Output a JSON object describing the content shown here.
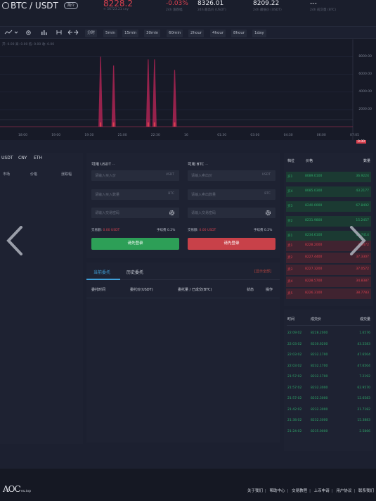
{
  "header": {
    "pair": "BTC / USDT",
    "intro_badge": "简介",
    "price": "8228.2",
    "price_sub": "≈ 56723.21 cny",
    "change": "-0.03%",
    "change_label": "24h 涨跌幅",
    "high": "8326.01",
    "high_label": "24h 最高价 (USDT)",
    "low": "8209.22",
    "low_label": "24h 最低价 (USDT)",
    "volume": "---",
    "volume_label": "24h 成交量 (BTC)"
  },
  "chart": {
    "toolbar": [
      "分时",
      "5min",
      "15min",
      "30min",
      "60min",
      "2hour",
      "4hour",
      "8hour",
      "1day"
    ],
    "legend": "开: 0.00  高: 0.00  低: 0.00  收: 0.00",
    "current_price_tag": "0.00",
    "colors": {
      "spike": "#c2265a",
      "accent": "#d9414f"
    }
  },
  "chart_data": {
    "type": "line",
    "x_ticks": [
      "18:00",
      "19:00",
      "19:30",
      "21:00",
      "22:30",
      "16",
      "01:30",
      "03:00",
      "04:30",
      "06:00",
      "07:05"
    ],
    "y_ticks": [
      "8000.00",
      "6000.00",
      "4000.00",
      "2000.00"
    ],
    "ylim": [
      0,
      9000
    ],
    "spikes": [
      {
        "x": 0.285,
        "value": 8000
      },
      {
        "x": 0.322,
        "value": 7000
      },
      {
        "x": 0.42,
        "value": 7700
      },
      {
        "x": 0.438,
        "value": 7700
      },
      {
        "x": 0.495,
        "value": 6500
      }
    ]
  },
  "market": {
    "tabs": [
      "USDT",
      "CNY",
      "ETH"
    ],
    "columns": [
      "市场",
      "价格",
      "涨跌幅"
    ]
  },
  "trade": {
    "buy_title": "可用 USDT",
    "buy_title_suffix": "--",
    "sell_title": "可用 BTC",
    "sell_title_suffix": "--",
    "buy_price_ph": "请输入买入价",
    "buy_amount_ph": "请输入买入数量",
    "buy_pwd_ph": "请输入交易密码",
    "sell_price_ph": "请输入卖出价",
    "sell_amount_ph": "请输入卖出数量",
    "sell_pwd_ph": "请输入交易密码",
    "unit_usdt": "USDT",
    "unit_btc": "BTC",
    "buy_total_label": "交易额:",
    "buy_total_value": "0.00 USDT",
    "buy_fee": "手续费 0.2%",
    "sell_total_label": "交易额:",
    "sell_total_value": "0.00 USDT",
    "sell_fee": "手续费 0.2%",
    "buy_button": "请先登录",
    "sell_button": "请先登录"
  },
  "orders": {
    "tab_current": "当前委托",
    "tab_history": "历史委托",
    "show_all": "[显示全部]",
    "columns": [
      "委托时间",
      "委托价(USDT)",
      "委托量 / 已成交(BTC)",
      "状态",
      "操作"
    ]
  },
  "book": {
    "columns": [
      "档位",
      "价格",
      "数量"
    ],
    "bids": [
      {
        "level": "买1",
        "price": "8089.0100",
        "amount": "36.9224"
      },
      {
        "level": "买4",
        "price": "8085.0300",
        "amount": "43.2177"
      },
      {
        "level": "买3",
        "price": "8240.0000",
        "amount": "67.8492"
      },
      {
        "level": "买2",
        "price": "8231.9800",
        "amount": "15.2457"
      },
      {
        "level": "买1",
        "price": "8234.6100",
        "amount": "15.7414"
      }
    ],
    "asks": [
      {
        "level": "卖1",
        "price": "8228.2000",
        "amount": "2.0472"
      },
      {
        "level": "卖2",
        "price": "8227.4400",
        "amount": "37.3307"
      },
      {
        "level": "卖3",
        "price": "8227.3200",
        "amount": "37.0572"
      },
      {
        "level": "卖4",
        "price": "8228.5700",
        "amount": "34.8387"
      },
      {
        "level": "卖5",
        "price": "8226.3100",
        "amount": "38.7783"
      }
    ]
  },
  "trades": {
    "columns": [
      "时间",
      "成交价",
      "成交量"
    ],
    "rows": [
      {
        "time": "22:09:02",
        "price": "8228.2000",
        "amount": "1.6576"
      },
      {
        "time": "22:03:02",
        "price": "8230.6200",
        "amount": "43.5583"
      },
      {
        "time": "22:03:02",
        "price": "8232.1700",
        "amount": "47.6504"
      },
      {
        "time": "22:03:02",
        "price": "8232.1700",
        "amount": "47.6504"
      },
      {
        "time": "21:57:02",
        "price": "8232.1700",
        "amount": "7.2192"
      },
      {
        "time": "21:57:02",
        "price": "8232.3000",
        "amount": "62.9570"
      },
      {
        "time": "21:57:02",
        "price": "8232.3000",
        "amount": "12.6583"
      },
      {
        "time": "21:42:02",
        "price": "8232.3000",
        "amount": "21.7182"
      },
      {
        "time": "21:38:02",
        "price": "8232.3000",
        "amount": "15.3883"
      },
      {
        "time": "21:24:02",
        "price": "8235.0000",
        "amount": "2.5866"
      }
    ]
  },
  "footer": {
    "logo": "AOC",
    "logo_sub": "ex.top",
    "links": [
      "关于我们",
      "帮助中心",
      "交易教程",
      "上币申请",
      "用户协议",
      "联系我们"
    ]
  }
}
